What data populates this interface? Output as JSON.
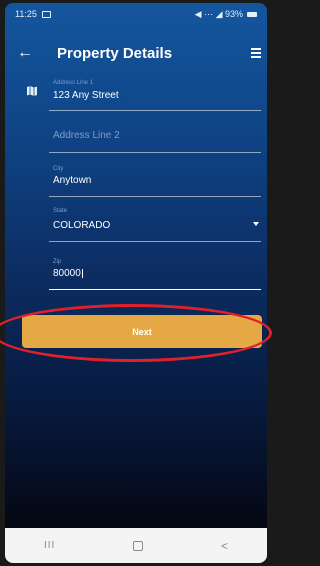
{
  "status_bar": {
    "time": "11:25",
    "right_text": "◀ ⋯ ◢ 93%"
  },
  "app_bar": {
    "title": "Property Details",
    "back_icon": "arrow-left",
    "menu_icon": "hamburger"
  },
  "form": {
    "address_line_1": {
      "label": "Address Line 1",
      "value": "123 Any Street"
    },
    "address_line_2": {
      "placeholder": "Address Line 2"
    },
    "city": {
      "label": "City",
      "value": "Anytown"
    },
    "state": {
      "label": "State",
      "value": "COLORADO"
    },
    "zip": {
      "label": "Zip",
      "value": "80000"
    }
  },
  "next_button": {
    "label": "Next"
  },
  "nav_bar": {
    "recent_label": "III",
    "back_label": "<"
  },
  "colors": {
    "primary": "#14569e",
    "button": "#e4a844",
    "highlight": "#e0202b"
  }
}
